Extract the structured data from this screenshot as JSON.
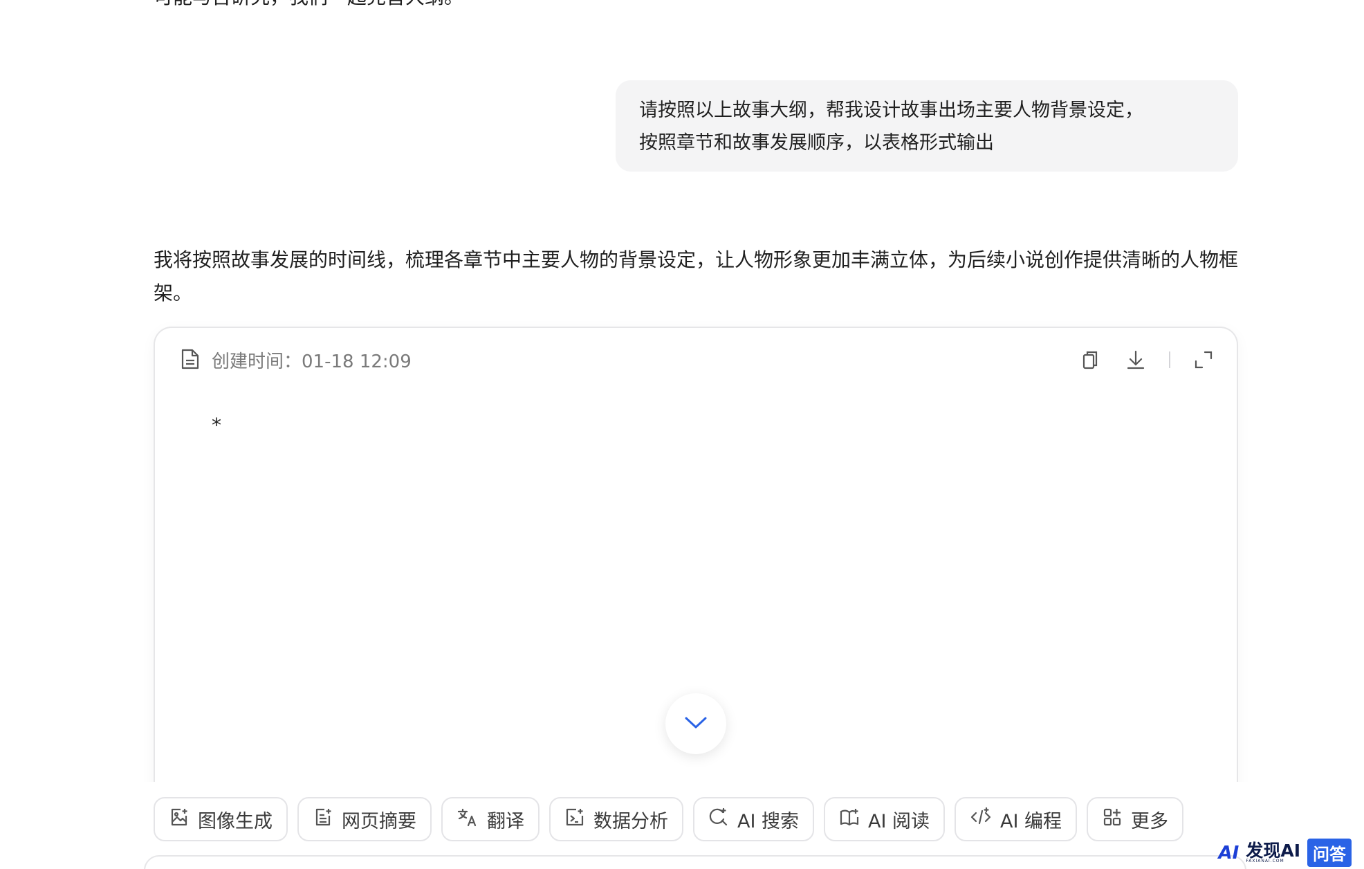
{
  "conversation": {
    "partial_top_text": "可能与否研究，我们一起完善大纲。",
    "user_message": {
      "line1": "请按照以上故事大纲，帮我设计故事出场主要人物背景设定，",
      "line2": "按照章节和故事发展顺序，以表格形式输出"
    },
    "assistant_intro": "我将按照故事发展的时间线，梳理各章节中主要人物的背景设定，让人物形象更加丰满立体，为后续小说创作提供清晰的人物框架。"
  },
  "document": {
    "created_time": "创建时间：01-18 12:09",
    "bullet": "*",
    "icons": {
      "doc": "document-icon",
      "copy": "copy-icon",
      "download": "download-icon",
      "expand": "expand-icon",
      "scroll": "chevron-down-icon"
    }
  },
  "toolbar": {
    "items": [
      {
        "label": "图像生成",
        "icon": "image-generate-icon"
      },
      {
        "label": "网页摘要",
        "icon": "web-summary-icon"
      },
      {
        "label": "翻译",
        "icon": "translate-icon"
      },
      {
        "label": "数据分析",
        "icon": "data-analysis-icon"
      },
      {
        "label": "AI 搜索",
        "icon": "ai-search-icon"
      },
      {
        "label": "AI 阅读",
        "icon": "ai-read-icon"
      },
      {
        "label": "AI 编程",
        "icon": "ai-code-icon"
      },
      {
        "label": "更多",
        "icon": "more-apps-icon"
      }
    ]
  },
  "watermark": {
    "logo": "AI",
    "name": "发现AI",
    "sub": "FAXIANAI.COM",
    "badge": "问答"
  },
  "colors": {
    "accent": "#2a63e6",
    "bubble_bg": "#f4f4f5",
    "border": "#e4e4e7"
  }
}
